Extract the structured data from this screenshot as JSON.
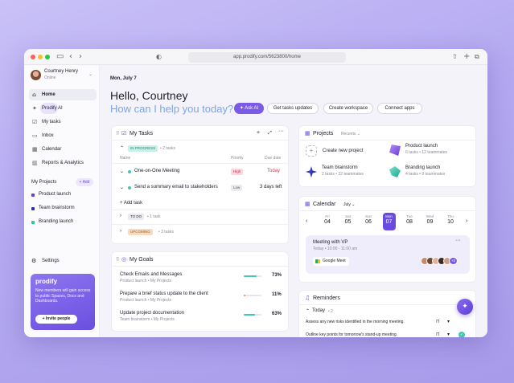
{
  "browser": {
    "url": "app.prodify.com/5623800/home"
  },
  "user": {
    "name": "Courtney Henry",
    "status": "Online"
  },
  "nav": [
    {
      "label": "Home"
    },
    {
      "label": "Prodify AI"
    },
    {
      "label": "My tasks"
    },
    {
      "label": "Inbox"
    },
    {
      "label": "Calendar"
    },
    {
      "label": "Reports & Analytics"
    }
  ],
  "projects_nav": {
    "title": "My Projects",
    "add": "+ Add",
    "items": [
      {
        "label": "Product launch",
        "color": "#6a3bd8"
      },
      {
        "label": "Team brainstorm",
        "color": "#2a2fb0"
      },
      {
        "label": "Branding launch",
        "color": "#2ec4a6"
      }
    ]
  },
  "settings": "Settings",
  "promo": {
    "brand": "prodify",
    "text": "New members will gain access to public Spaces, Docs and Dashboards.",
    "button": "+ Invite people"
  },
  "header": {
    "date": "Mon, July 7",
    "greeting": "Hello, Courtney",
    "question": "How can I help you today?",
    "ask_ai": "✦ Ask AI",
    "actions": [
      "Get tasks updates",
      "Create workspace",
      "Connect apps"
    ]
  },
  "tasks": {
    "title": "My Tasks",
    "cols": [
      "Name",
      "Priority",
      "Due date"
    ],
    "in_progress": {
      "label": "IN PROGRESS",
      "count": "• 2 tasks"
    },
    "rows": [
      {
        "name": "One-on-One Meeting",
        "priority": "High",
        "due": "Today"
      },
      {
        "name": "Send a summary email to stakeholders",
        "priority": "Low",
        "due": "3 days left"
      }
    ],
    "add": "+ Add task",
    "todo": {
      "label": "TO DO",
      "count": "• 1 task"
    },
    "upcoming": {
      "label": "UPCOMING",
      "count": "• 3 tasks"
    }
  },
  "goals": {
    "title": "My Goals",
    "items": [
      {
        "name": "Check Emails and Messages",
        "sub": "Product launch  •  My Projects",
        "pct": "73%",
        "value": 0.73,
        "color": "#3fc8b4"
      },
      {
        "name": "Prepare a brief status update to the client",
        "sub": "Product launch  •  My Projects",
        "pct": "11%",
        "value": 0.11,
        "color": "#f0883e"
      },
      {
        "name": "Update project documentation",
        "sub": "Team brainstorm  •  My Projects",
        "pct": "63%",
        "value": 0.63,
        "color": "#3fc8b4"
      }
    ]
  },
  "projects": {
    "title": "Projects",
    "filter": "Recents",
    "create": "Create new project",
    "items": [
      {
        "name": "Product launch",
        "meta": "6 tasks  •  12 teammates"
      },
      {
        "name": "Team brainstorm",
        "meta": "2 tasks  •  32 teammates"
      },
      {
        "name": "Branding launch",
        "meta": "4 tasks  •  9 teammates"
      }
    ]
  },
  "calendar": {
    "title": "Calendar",
    "month": "July",
    "days": [
      {
        "d": "Fri",
        "n": "04"
      },
      {
        "d": "Sat",
        "n": "05"
      },
      {
        "d": "Sun",
        "n": "06"
      },
      {
        "d": "Mon",
        "n": "07"
      },
      {
        "d": "Tue",
        "n": "08"
      },
      {
        "d": "Wed",
        "n": "09"
      },
      {
        "d": "Thu",
        "n": "10"
      }
    ],
    "event": {
      "title": "Meeting with VP",
      "time": "Today  •  10:00 - 11:00 am",
      "app": "Google Meet",
      "more": "+2"
    }
  },
  "reminders": {
    "title": "Reminders",
    "group": "Today",
    "count": "• 2",
    "items": [
      "Assess any new risks identified in the morning meeting.",
      "Outline key points for tomorrow's stand-up meeting."
    ]
  }
}
